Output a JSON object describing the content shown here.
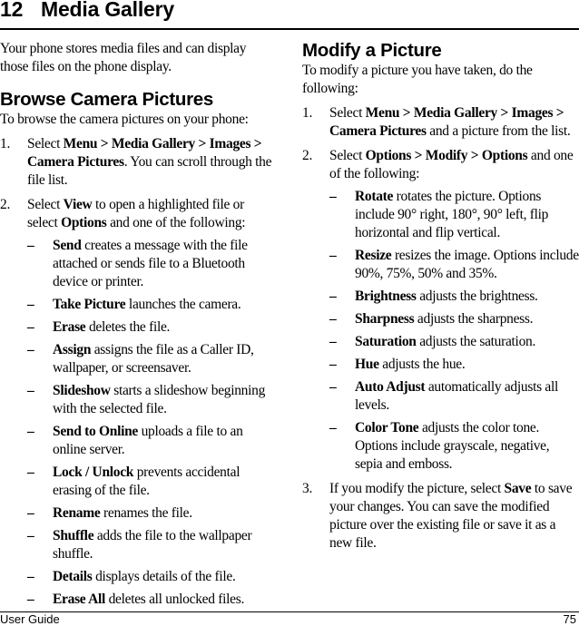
{
  "header": {
    "chapter_number": "12",
    "chapter_title": "Media Gallery"
  },
  "intro": "Your phone stores media files and can display those files on the phone display.",
  "browse": {
    "heading": "Browse Camera Pictures",
    "lead": "To browse the camera pictures on your phone:",
    "steps": [
      {
        "num": "1.",
        "pre": "Select ",
        "bold": "Menu > Media Gallery > Images > Camera Pictures",
        "post": ". You can scroll through the file list."
      },
      {
        "num": "2.",
        "pre": "Select ",
        "bold": "View",
        "mid": " to open a highlighted file or select ",
        "bold2": "Options",
        "post": " and one of the following:",
        "options": [
          {
            "dash": "–",
            "name": "Send",
            "desc": " creates a message with the file attached or sends file to a Bluetooth device or printer."
          },
          {
            "dash": "–",
            "name": "Take Picture",
            "desc": " launches the camera."
          },
          {
            "dash": "–",
            "name": "Erase",
            "desc": " deletes the file."
          },
          {
            "dash": "–",
            "name": "Assign",
            "desc": " assigns the file as a Caller ID, wallpaper, or screensaver."
          },
          {
            "dash": "–",
            "name": "Slideshow",
            "desc": " starts a slideshow beginning with the selected file."
          },
          {
            "dash": "–",
            "name": "Send to Online",
            "desc": " uploads a file to an online server."
          },
          {
            "dash": "–",
            "name": "Lock / Unlock",
            "desc": " prevents accidental erasing of the file."
          },
          {
            "dash": "–",
            "name": "Rename",
            "desc": " renames the file."
          },
          {
            "dash": "–",
            "name": "Shuffle",
            "desc": " adds the file to the wallpaper shuffle."
          },
          {
            "dash": "–",
            "name": "Details",
            "desc": " displays details of the file."
          },
          {
            "dash": "–",
            "name": "Erase All",
            "desc": " deletes all unlocked files."
          }
        ]
      }
    ]
  },
  "modify": {
    "heading": "Modify a Picture",
    "lead": "To modify a picture you have taken, do the following:",
    "steps": [
      {
        "num": "1.",
        "pre": "Select ",
        "bold": "Menu > Media Gallery > Images > Camera Pictures",
        "post": " and a picture from the list."
      },
      {
        "num": "2.",
        "pre": "Select ",
        "bold": "Options > Modify > Options",
        "post": " and one of the following:",
        "options": [
          {
            "dash": "–",
            "name": "Rotate",
            "desc": " rotates the picture. Options include 90° right, 180°, 90° left, flip horizontal and flip vertical."
          },
          {
            "dash": "–",
            "name": "Resize",
            "desc": " resizes the image. Options include 90%, 75%, 50% and 35%."
          },
          {
            "dash": "–",
            "name": "Brightness",
            "desc": " adjusts the brightness."
          },
          {
            "dash": "–",
            "name": "Sharpness",
            "desc": " adjusts the sharpness."
          },
          {
            "dash": "–",
            "name": "Saturation",
            "desc": " adjusts the saturation."
          },
          {
            "dash": "–",
            "name": "Hue",
            "desc": " adjusts the hue."
          },
          {
            "dash": "–",
            "name": "Auto Adjust",
            "desc": " automatically adjusts all levels."
          },
          {
            "dash": "–",
            "name": "Color Tone",
            "desc": " adjusts the color tone. Options include grayscale, negative, sepia and emboss."
          }
        ]
      },
      {
        "num": "3.",
        "pre": "If you modify the picture, select ",
        "bold": "Save",
        "post": " to save your changes. You can save the modified picture over the existing file or save it as a new file."
      }
    ]
  },
  "footer": {
    "left": "User Guide",
    "page_number": "75"
  }
}
